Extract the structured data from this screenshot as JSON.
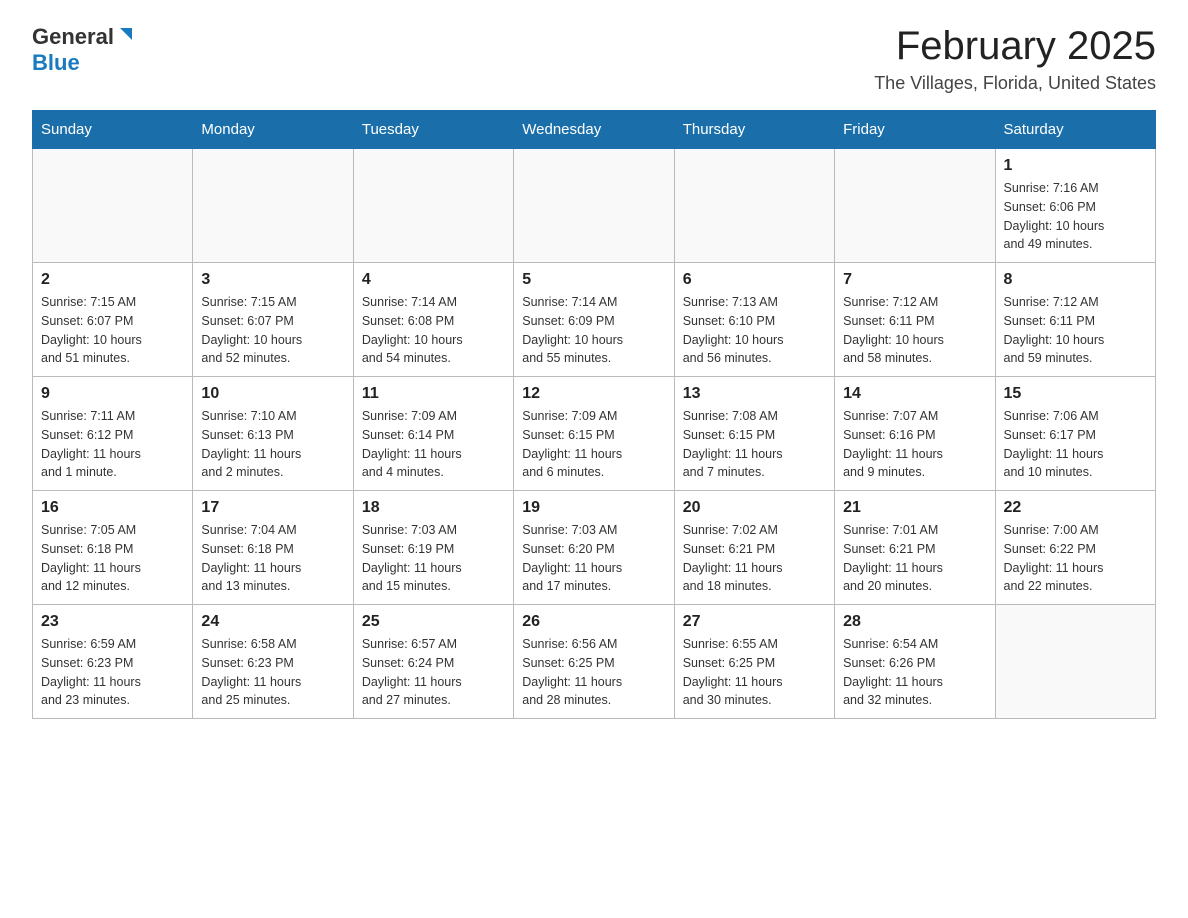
{
  "header": {
    "month_title": "February 2025",
    "location": "The Villages, Florida, United States",
    "logo_general": "General",
    "logo_blue": "Blue"
  },
  "days_of_week": [
    "Sunday",
    "Monday",
    "Tuesday",
    "Wednesday",
    "Thursday",
    "Friday",
    "Saturday"
  ],
  "weeks": [
    [
      {
        "day": "",
        "info": ""
      },
      {
        "day": "",
        "info": ""
      },
      {
        "day": "",
        "info": ""
      },
      {
        "day": "",
        "info": ""
      },
      {
        "day": "",
        "info": ""
      },
      {
        "day": "",
        "info": ""
      },
      {
        "day": "1",
        "info": "Sunrise: 7:16 AM\nSunset: 6:06 PM\nDaylight: 10 hours\nand 49 minutes."
      }
    ],
    [
      {
        "day": "2",
        "info": "Sunrise: 7:15 AM\nSunset: 6:07 PM\nDaylight: 10 hours\nand 51 minutes."
      },
      {
        "day": "3",
        "info": "Sunrise: 7:15 AM\nSunset: 6:07 PM\nDaylight: 10 hours\nand 52 minutes."
      },
      {
        "day": "4",
        "info": "Sunrise: 7:14 AM\nSunset: 6:08 PM\nDaylight: 10 hours\nand 54 minutes."
      },
      {
        "day": "5",
        "info": "Sunrise: 7:14 AM\nSunset: 6:09 PM\nDaylight: 10 hours\nand 55 minutes."
      },
      {
        "day": "6",
        "info": "Sunrise: 7:13 AM\nSunset: 6:10 PM\nDaylight: 10 hours\nand 56 minutes."
      },
      {
        "day": "7",
        "info": "Sunrise: 7:12 AM\nSunset: 6:11 PM\nDaylight: 10 hours\nand 58 minutes."
      },
      {
        "day": "8",
        "info": "Sunrise: 7:12 AM\nSunset: 6:11 PM\nDaylight: 10 hours\nand 59 minutes."
      }
    ],
    [
      {
        "day": "9",
        "info": "Sunrise: 7:11 AM\nSunset: 6:12 PM\nDaylight: 11 hours\nand 1 minute."
      },
      {
        "day": "10",
        "info": "Sunrise: 7:10 AM\nSunset: 6:13 PM\nDaylight: 11 hours\nand 2 minutes."
      },
      {
        "day": "11",
        "info": "Sunrise: 7:09 AM\nSunset: 6:14 PM\nDaylight: 11 hours\nand 4 minutes."
      },
      {
        "day": "12",
        "info": "Sunrise: 7:09 AM\nSunset: 6:15 PM\nDaylight: 11 hours\nand 6 minutes."
      },
      {
        "day": "13",
        "info": "Sunrise: 7:08 AM\nSunset: 6:15 PM\nDaylight: 11 hours\nand 7 minutes."
      },
      {
        "day": "14",
        "info": "Sunrise: 7:07 AM\nSunset: 6:16 PM\nDaylight: 11 hours\nand 9 minutes."
      },
      {
        "day": "15",
        "info": "Sunrise: 7:06 AM\nSunset: 6:17 PM\nDaylight: 11 hours\nand 10 minutes."
      }
    ],
    [
      {
        "day": "16",
        "info": "Sunrise: 7:05 AM\nSunset: 6:18 PM\nDaylight: 11 hours\nand 12 minutes."
      },
      {
        "day": "17",
        "info": "Sunrise: 7:04 AM\nSunset: 6:18 PM\nDaylight: 11 hours\nand 13 minutes."
      },
      {
        "day": "18",
        "info": "Sunrise: 7:03 AM\nSunset: 6:19 PM\nDaylight: 11 hours\nand 15 minutes."
      },
      {
        "day": "19",
        "info": "Sunrise: 7:03 AM\nSunset: 6:20 PM\nDaylight: 11 hours\nand 17 minutes."
      },
      {
        "day": "20",
        "info": "Sunrise: 7:02 AM\nSunset: 6:21 PM\nDaylight: 11 hours\nand 18 minutes."
      },
      {
        "day": "21",
        "info": "Sunrise: 7:01 AM\nSunset: 6:21 PM\nDaylight: 11 hours\nand 20 minutes."
      },
      {
        "day": "22",
        "info": "Sunrise: 7:00 AM\nSunset: 6:22 PM\nDaylight: 11 hours\nand 22 minutes."
      }
    ],
    [
      {
        "day": "23",
        "info": "Sunrise: 6:59 AM\nSunset: 6:23 PM\nDaylight: 11 hours\nand 23 minutes."
      },
      {
        "day": "24",
        "info": "Sunrise: 6:58 AM\nSunset: 6:23 PM\nDaylight: 11 hours\nand 25 minutes."
      },
      {
        "day": "25",
        "info": "Sunrise: 6:57 AM\nSunset: 6:24 PM\nDaylight: 11 hours\nand 27 minutes."
      },
      {
        "day": "26",
        "info": "Sunrise: 6:56 AM\nSunset: 6:25 PM\nDaylight: 11 hours\nand 28 minutes."
      },
      {
        "day": "27",
        "info": "Sunrise: 6:55 AM\nSunset: 6:25 PM\nDaylight: 11 hours\nand 30 minutes."
      },
      {
        "day": "28",
        "info": "Sunrise: 6:54 AM\nSunset: 6:26 PM\nDaylight: 11 hours\nand 32 minutes."
      },
      {
        "day": "",
        "info": ""
      }
    ]
  ]
}
